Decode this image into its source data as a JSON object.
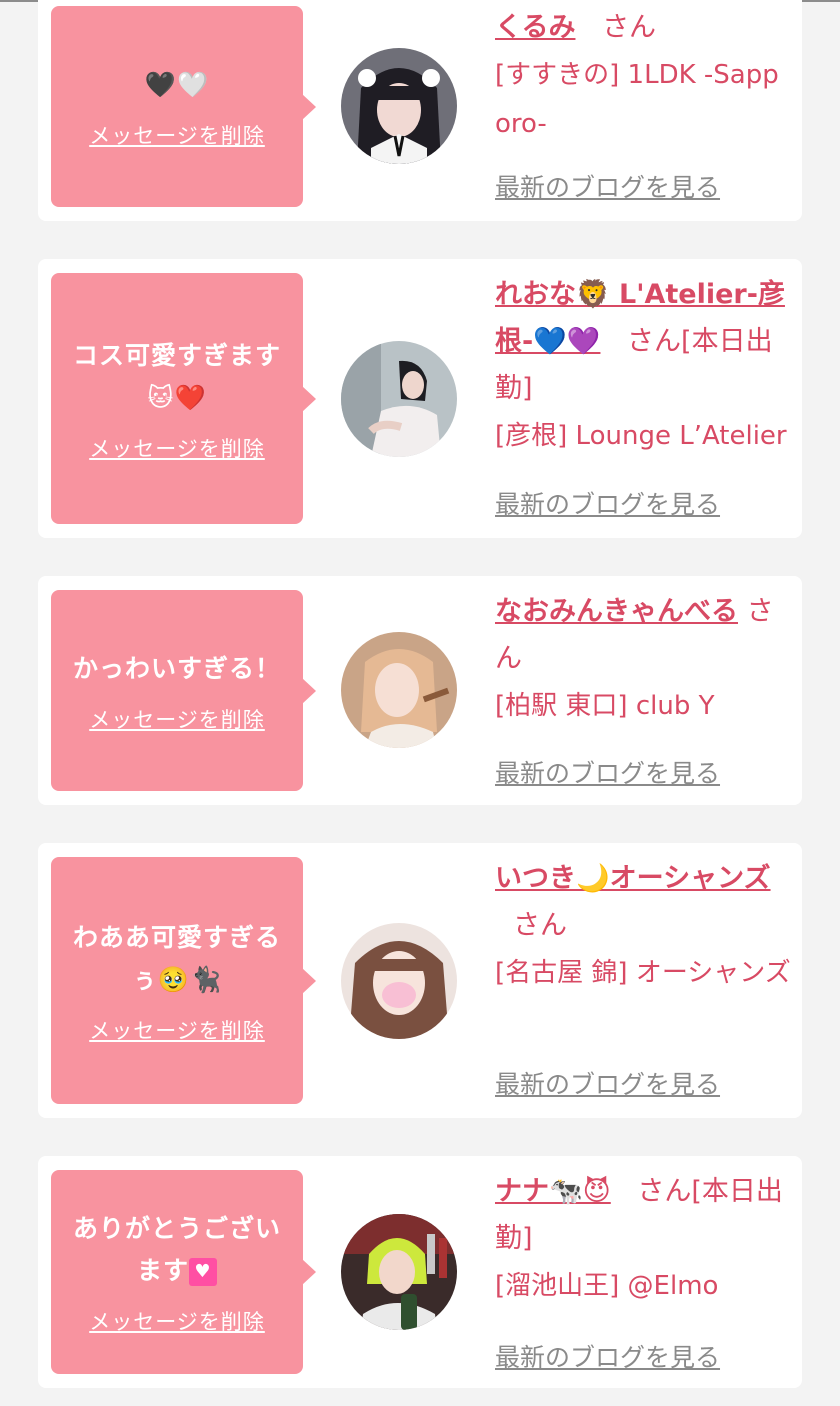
{
  "cards": [
    {
      "message": "🖤🤍",
      "delete_label": "メッセージを削除",
      "name": "くるみ",
      "honorific": "さん",
      "shop": "[すすきの] 1LDK -Sapporo-",
      "blog_label": "最新のブログを見る"
    },
    {
      "message": "コス可愛すぎます🐱❤️",
      "delete_label": "メッセージを削除",
      "name": "れおな🦁 L'Atelier-彦根-💙💜",
      "honorific": "さん[本日出勤]",
      "shop": "[彦根] Lounge L’Atelier",
      "blog_label": "最新のブログを見る"
    },
    {
      "message": "かっわいすぎる！",
      "delete_label": "メッセージを削除",
      "name": "なおみんきゃんべる",
      "honorific": "さん",
      "shop": "[柏駅 東口] club Y",
      "blog_label": "最新のブログを見る"
    },
    {
      "message": "わああ可愛すぎるぅ🥹🐈‍⬛",
      "delete_label": "メッセージを削除",
      "name": "いつき🌙オーシャンズ",
      "honorific": "さん",
      "shop": "[名古屋 錦] オーシャンズ",
      "blog_label": "最新のブログを見る"
    },
    {
      "message": "ありがとうございます💟",
      "delete_label": "メッセージを削除",
      "name": "ナナ🐄😈",
      "honorific": "さん[本日出勤]",
      "shop": "[溜池山王] @Elmo",
      "blog_label": "最新のブログを見る"
    }
  ]
}
